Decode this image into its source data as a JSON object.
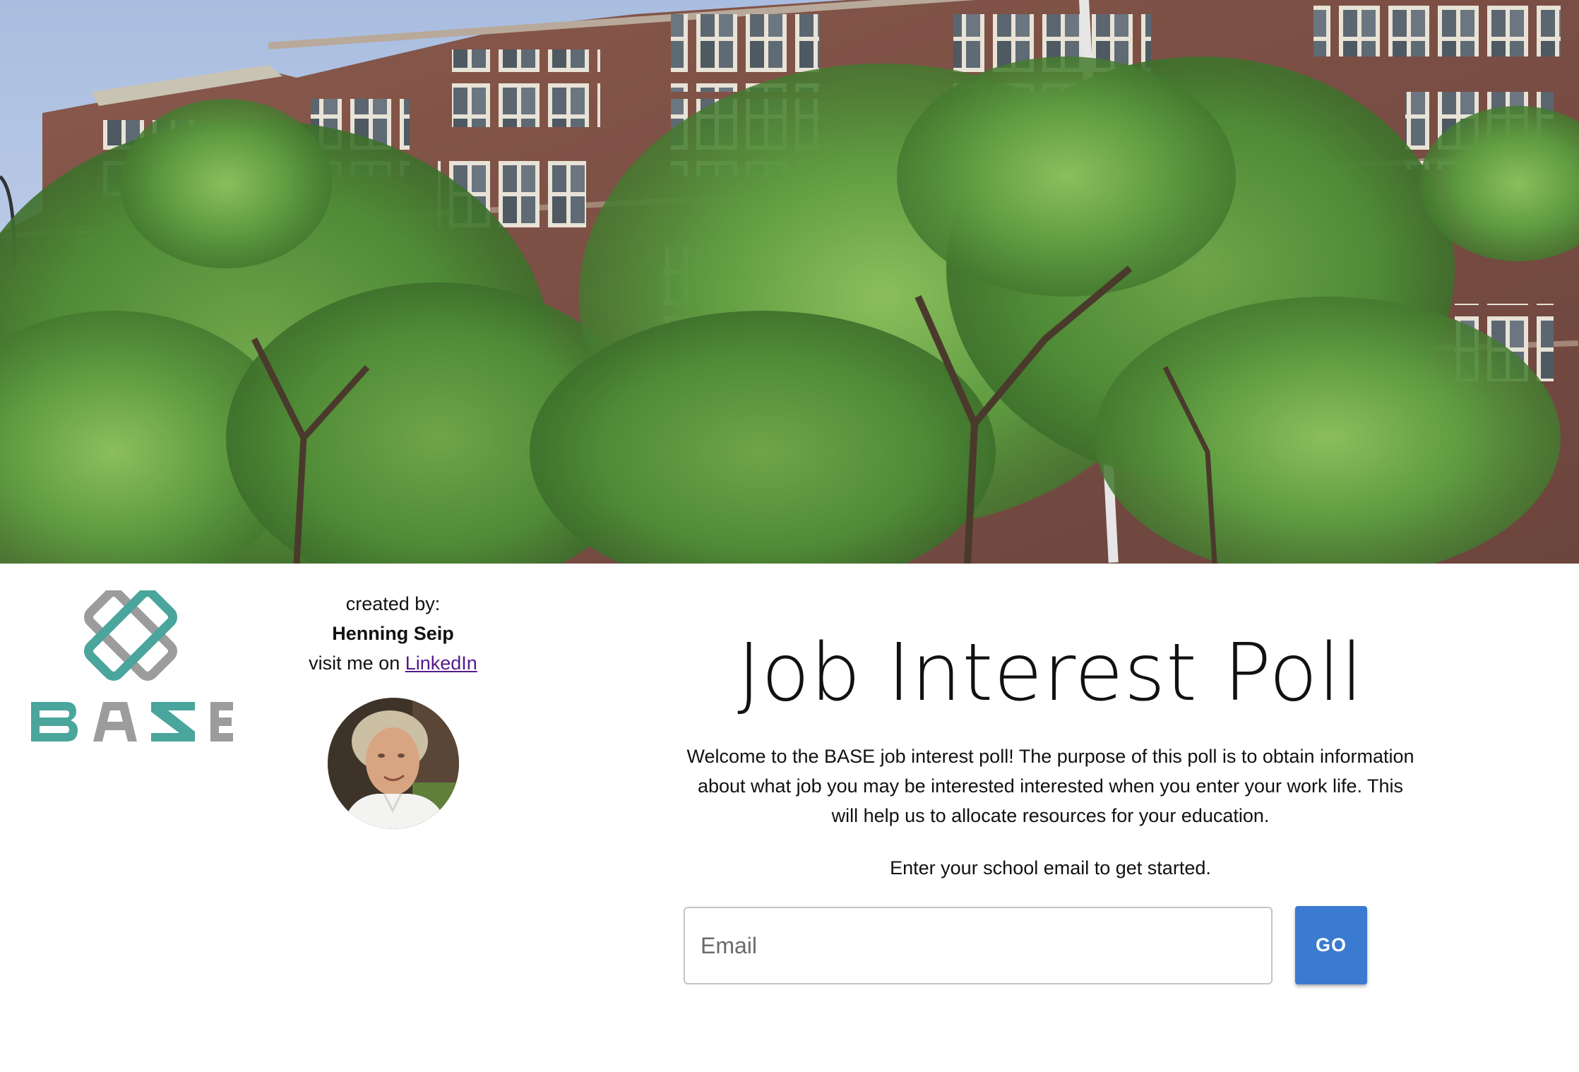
{
  "hero": {
    "image": "school-building-with-trees"
  },
  "logo": {
    "wordmark": "BASE",
    "color_primary": "#4aa59c",
    "color_secondary": "#9c9c9c"
  },
  "creator": {
    "created_by_label": "created by:",
    "name": "Henning Seip",
    "visit_prefix": "visit me on ",
    "link_label": "LinkedIn",
    "avatar": "profile-photo"
  },
  "main": {
    "title": "Job Interest Poll",
    "description": "Welcome to the BASE job interest poll! The purpose of this poll is to obtain information about what job you may be interested interested when you enter your work life. This will help us to allocate resources for your education.",
    "prompt": "Enter your school email to get started.",
    "email_placeholder": "Email",
    "email_value": "",
    "go_label": "GO",
    "accent_color": "#3b7ad1"
  }
}
